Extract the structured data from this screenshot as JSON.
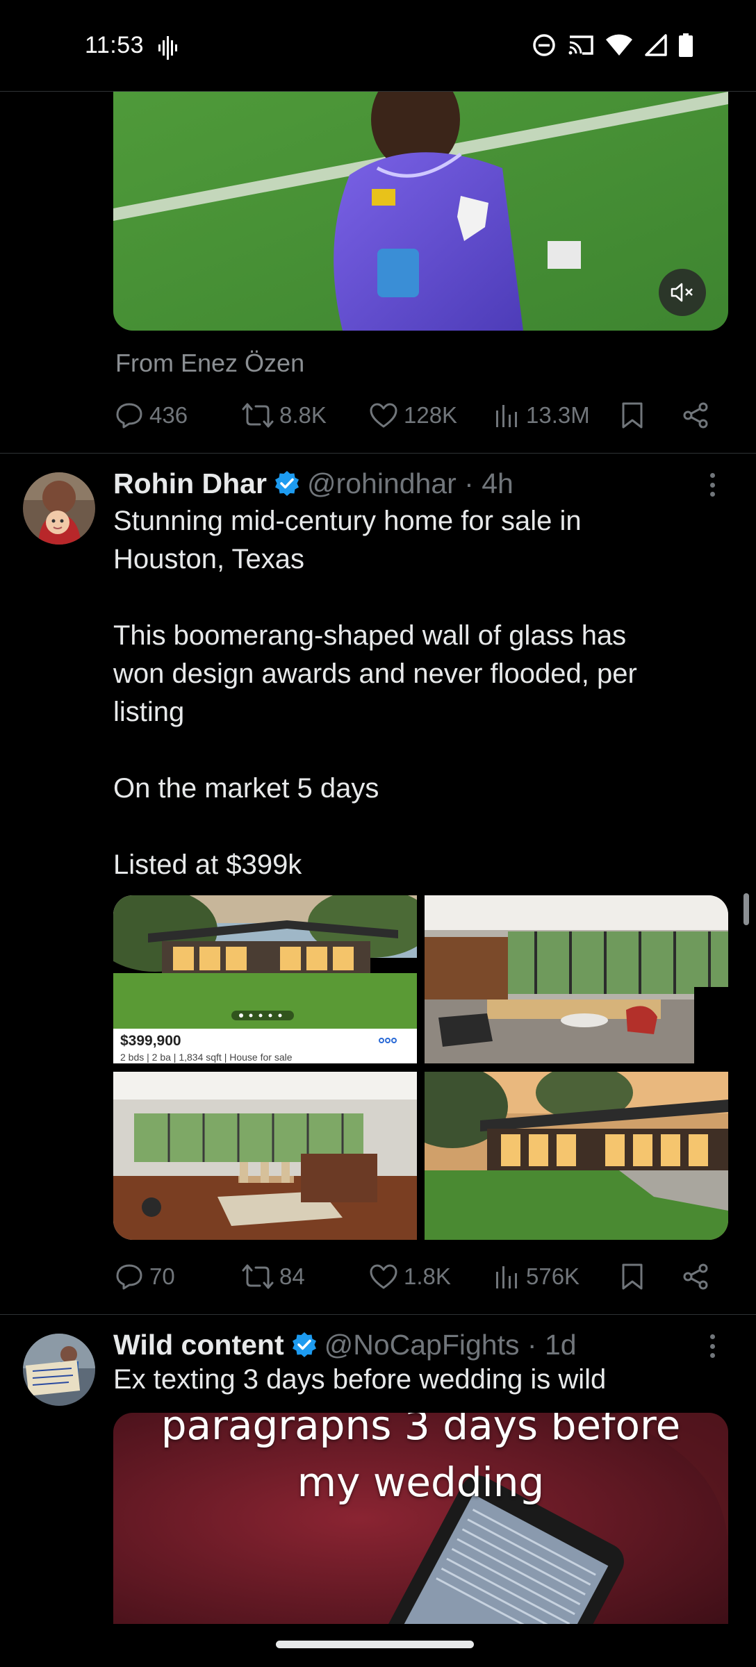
{
  "status_bar": {
    "time": "11:53"
  },
  "tweet1": {
    "from_text": "From Enez Özen",
    "stats": {
      "replies": "436",
      "reposts": "8.8K",
      "likes": "128K",
      "views": "13.3M"
    }
  },
  "tweet2": {
    "display_name": "Rohin Dhar",
    "handle_time": "@rohindhar · 4h",
    "text": {
      "line1": "Stunning mid-century home for sale in",
      "line2": "Houston, Texas",
      "line3": "This boomerang-shaped wall of glass has",
      "line4": "won design awards and never flooded, per",
      "line5": "listing",
      "line6": "On the market 5 days",
      "line7": "Listed at $399k"
    },
    "listing": {
      "price": "$399,900",
      "details": "2 bds | 2 ba | 1,834 sqft | House for sale"
    },
    "stats": {
      "replies": "70",
      "reposts": "84",
      "likes": "1.8K",
      "views": "576K"
    }
  },
  "tweet3": {
    "display_name": "Wild content",
    "handle_time": "@NoCapFights · 1d",
    "text": "Ex texting 3 days before wedding is wild",
    "video_caption_1": "paragrapns 3 days before",
    "video_caption_2": "my wedding"
  },
  "colors": {
    "background": "#000000",
    "text": "#e7e9ea",
    "muted": "#71767b",
    "verified": "#1d9bf0",
    "divider": "#2f3336"
  },
  "icons": [
    "reply-icon",
    "repost-icon",
    "like-icon",
    "views-icon",
    "bookmark-icon",
    "share-icon",
    "mute-icon",
    "verified-badge-icon"
  ]
}
